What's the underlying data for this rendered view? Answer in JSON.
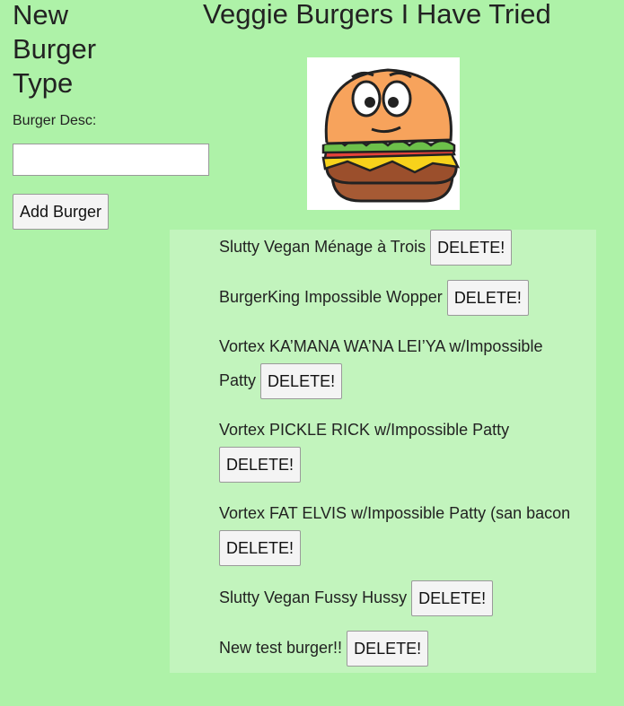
{
  "form": {
    "title": "New Burger Type",
    "desc_label": "Burger Desc:",
    "desc_value": "",
    "desc_placeholder": "",
    "add_label": "Add Burger"
  },
  "main": {
    "title": "Veggie Burgers I Have Tried",
    "image_icon": "cartoon-burger-image"
  },
  "burgers": [
    {
      "name": "Slutty Vegan Ménage à Trois",
      "delete_label": "DELETE!"
    },
    {
      "name": "BurgerKing Impossible Wopper",
      "delete_label": "DELETE!"
    },
    {
      "name": "Vortex KA’MANA WA’NA LEI’YA w/Impossible Patty",
      "delete_label": "DELETE!"
    },
    {
      "name": "Vortex PICKLE RICK w/Impossible Patty",
      "delete_label": "DELETE!"
    },
    {
      "name": "Vortex FAT ELVIS w/Impossible Patty (san bacon",
      "delete_label": "DELETE!"
    },
    {
      "name": "Slutty Vegan Fussy Hussy",
      "delete_label": "DELETE!"
    },
    {
      "name": "New test burger!!",
      "delete_label": "DELETE!"
    }
  ]
}
